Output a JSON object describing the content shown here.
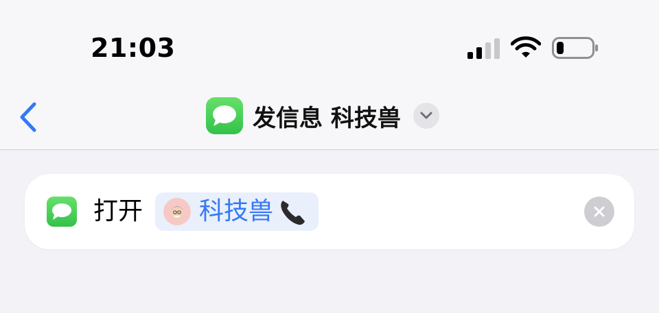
{
  "status_bar": {
    "time": "21:03",
    "icons": [
      "cellular-signal-icon",
      "wifi-icon",
      "battery-icon"
    ]
  },
  "nav": {
    "back_icon": "chevron-left-icon",
    "app_icon": "messages-icon",
    "title": "发信息 科技兽",
    "dropdown_icon": "chevron-down-icon"
  },
  "action": {
    "app_icon": "messages-icon",
    "verb": "打开",
    "contact_token": {
      "avatar_icon": "memoji-avatar-icon",
      "name": "科技兽",
      "suffix_icon": "telephone-receiver-icon"
    },
    "clear_icon": "clear-x-icon"
  },
  "colors": {
    "accent": "#3478f6",
    "messages_green": "#34c759",
    "token_bg": "#e9f0fb",
    "page_bg": "#f2f2f7"
  }
}
